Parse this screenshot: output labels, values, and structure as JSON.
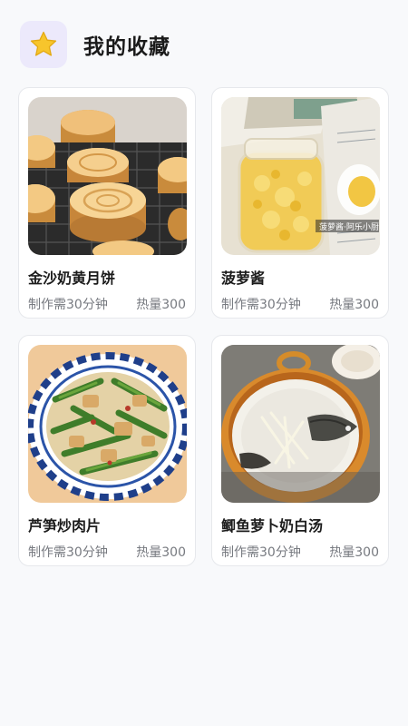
{
  "header": {
    "title": "我的收藏",
    "icon": "star-icon"
  },
  "colors": {
    "page_background": "#f8f9fb",
    "icon_tile": "#ece9fb",
    "star": "#f7c52c",
    "meta_text": "#777a80"
  },
  "recipes": [
    {
      "title": "金沙奶黄月饼",
      "time": "制作需30分钟",
      "calories": "热量300",
      "image": "mooncake-photo"
    },
    {
      "title": "菠萝酱",
      "time": "制作需30分钟",
      "calories": "热量300",
      "image": "pineapple-jam-photo",
      "image_caption": "菠萝酱·阿乐小厨"
    },
    {
      "title": "芦笋炒肉片",
      "time": "制作需30分钟",
      "calories": "热量300",
      "image": "asparagus-pork-photo"
    },
    {
      "title": "鲫鱼萝卜奶白汤",
      "time": "制作需30分钟",
      "calories": "热量300",
      "image": "fish-soup-photo"
    }
  ]
}
